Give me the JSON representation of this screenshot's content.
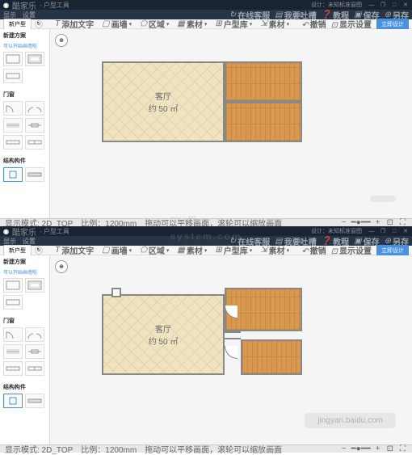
{
  "titlebar": {
    "logo": "◉",
    "app_name": "酷家乐",
    "title_suffix": "- 户型工具",
    "right_info": "设计：未知标准窗图",
    "min": "—",
    "max": "□",
    "restore": "❐",
    "close": "✕"
  },
  "menubar": {
    "items": [
      "显示",
      "设置"
    ],
    "right": [
      {
        "icon": "↻",
        "label": "在线客服"
      },
      {
        "icon": "▤",
        "label": "我要吐槽"
      },
      {
        "icon": "❓",
        "label": "教程"
      },
      {
        "icon": "▣",
        "label": "保存"
      },
      {
        "icon": "⊕",
        "label": "另存"
      }
    ]
  },
  "toolbar": {
    "tab": "新户型",
    "center_tools": [
      {
        "icon": "T",
        "label": "添加文字"
      },
      {
        "icon": "▢",
        "label": "画墙"
      },
      {
        "icon": "⬠",
        "label": "区域"
      },
      {
        "icon": "▦",
        "label": "素材"
      },
      {
        "icon": "⊞",
        "label": "户型库"
      },
      {
        "icon": "⇲",
        "label": "素材"
      }
    ],
    "right_tools": [
      {
        "icon": "↶",
        "label": "撤销"
      },
      {
        "icon": "⊡",
        "label": "显示设置"
      }
    ],
    "primary": "立即设计"
  },
  "sidebar": {
    "section1_title": "新建方案",
    "section1_sub": "可以开始画墙啦",
    "section2_title": "门窗",
    "section3_title": "结构构件"
  },
  "canvas": {
    "compass": "⊕",
    "room1_label": "客厅",
    "room1_area": "约 50 ㎡"
  },
  "statusbar": {
    "info1": "显示模式: 2D_TOP",
    "info2": "比例：1200mm",
    "hint": "拖动可以平移画面，滚轮可以缩放画面",
    "zoom_out": "−",
    "zoom_in": "+",
    "fit": "⊡",
    "full": "⛶"
  },
  "watermark": {
    "main": "GX i 网",
    "sub": "system.com"
  },
  "placeholder": "jingyan.baidu.com"
}
